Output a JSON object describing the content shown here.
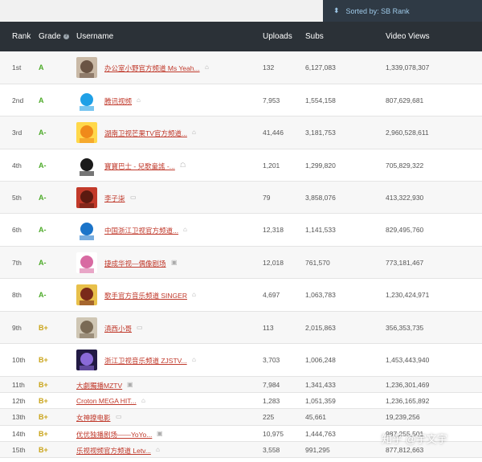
{
  "sort_label": "Sorted by: SB Rank",
  "columns": {
    "rank": "Rank",
    "grade": "Grade",
    "username": "Username",
    "uploads": "Uploads",
    "subs": "Subs",
    "views": "Video Views"
  },
  "rows": [
    {
      "rank": "1st",
      "grade": "A",
      "username": "办公室小野官方频道 Ms Yeah...",
      "uploads": "132",
      "subs": "6,127,083",
      "views": "1,339,078,307"
    },
    {
      "rank": "2nd",
      "grade": "A",
      "username": "腾讯视频",
      "uploads": "7,953",
      "subs": "1,554,158",
      "views": "807,629,681"
    },
    {
      "rank": "3rd",
      "grade": "A-",
      "username": "湖南卫视芒果TV官方频道...",
      "uploads": "41,446",
      "subs": "3,181,753",
      "views": "2,960,528,611"
    },
    {
      "rank": "4th",
      "grade": "A-",
      "username": "寶寶巴士 - 兒歌童謠 -...",
      "uploads": "1,201",
      "subs": "1,299,820",
      "views": "705,829,322"
    },
    {
      "rank": "5th",
      "grade": "A-",
      "username": "李子柒",
      "uploads": "79",
      "subs": "3,858,076",
      "views": "413,322,930"
    },
    {
      "rank": "6th",
      "grade": "A-",
      "username": "中国浙江卫视官方频道...",
      "uploads": "12,318",
      "subs": "1,141,533",
      "views": "829,495,760"
    },
    {
      "rank": "7th",
      "grade": "A-",
      "username": "捷成华视—偶像剧场",
      "uploads": "12,018",
      "subs": "761,570",
      "views": "773,181,467"
    },
    {
      "rank": "8th",
      "grade": "A-",
      "username": "歌手官方音乐频道 SINGER",
      "uploads": "4,697",
      "subs": "1,063,783",
      "views": "1,230,424,971"
    },
    {
      "rank": "9th",
      "grade": "B+",
      "username": "滇西小哥",
      "uploads": "113",
      "subs": "2,015,863",
      "views": "356,353,735"
    },
    {
      "rank": "10th",
      "grade": "B+",
      "username": "浙江卫视音乐频道 ZJSTV...",
      "uploads": "3,703",
      "subs": "1,006,248",
      "views": "1,453,443,940"
    },
    {
      "rank": "11th",
      "grade": "B+",
      "username": "大劇獨播MZTV",
      "uploads": "7,984",
      "subs": "1,341,433",
      "views": "1,236,301,469"
    },
    {
      "rank": "12th",
      "grade": "B+",
      "username": "Croton MEGA HIT...",
      "uploads": "1,283",
      "subs": "1,051,359",
      "views": "1,236,165,892"
    },
    {
      "rank": "13th",
      "grade": "B+",
      "username": "女神撩电影",
      "uploads": "225",
      "subs": "45,661",
      "views": "19,239,256"
    },
    {
      "rank": "14th",
      "grade": "B+",
      "username": "优优独播剧场——YoYo...",
      "uploads": "10,975",
      "subs": "1,444,763",
      "views": "987,255,501"
    },
    {
      "rank": "15th",
      "grade": "B+",
      "username": "乐视视频官方频道 Letv...",
      "uploads": "3,558",
      "subs": "991,295",
      "views": "877,812,663"
    }
  ],
  "watermark": "知乎 @宇文宇",
  "colors": {
    "header_bg": "#2b3137",
    "grade_a": "#4caa28",
    "grade_b": "#caa41a",
    "link": "#c0392b"
  }
}
